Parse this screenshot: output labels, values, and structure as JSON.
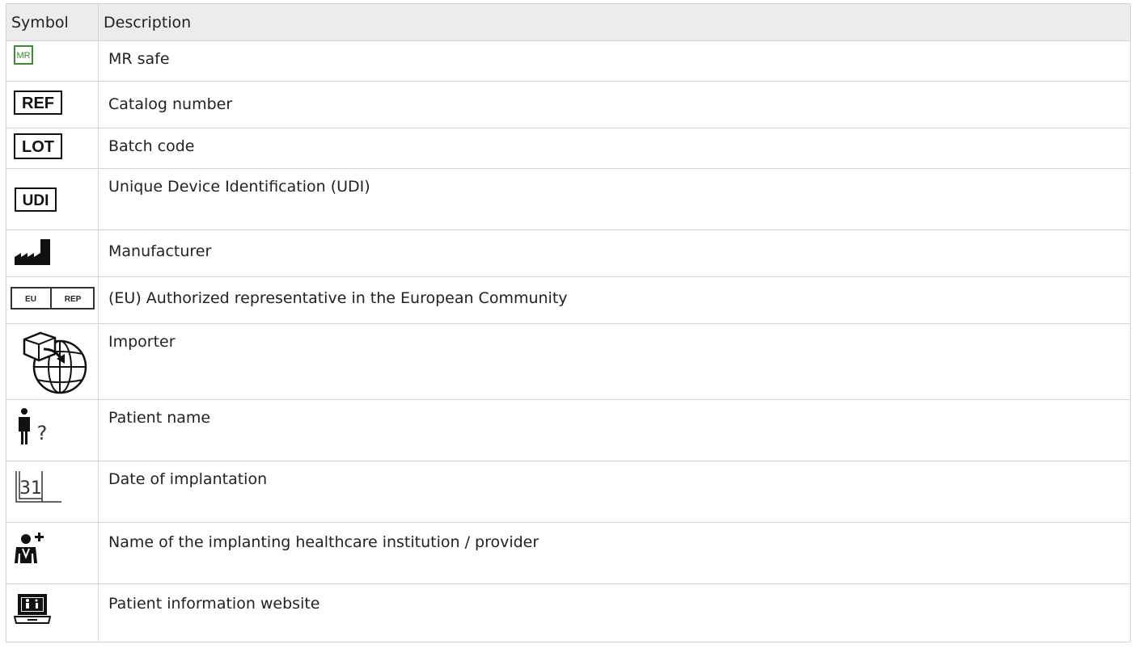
{
  "table": {
    "headers": [
      "Symbol",
      "Description"
    ],
    "rows": [
      {
        "icon": "mr-safe-icon",
        "description": "MR safe",
        "icon_text": "MR",
        "icon_color": "#3a8a3a"
      },
      {
        "icon": "ref-catalog-icon",
        "description": "Catalog number",
        "icon_text": "REF"
      },
      {
        "icon": "lot-batch-icon",
        "description": "Batch code",
        "icon_text": "LOT"
      },
      {
        "icon": "udi-icon",
        "description": "Unique Device Identification (UDI)",
        "icon_text": "UDI"
      },
      {
        "icon": "manufacturer-factory-icon",
        "description": "Manufacturer"
      },
      {
        "icon": "eu-rep-icon",
        "description": "(EU) Authorized representative in the European Community",
        "icon_text": "EU REP"
      },
      {
        "icon": "importer-globe-box-icon",
        "description": "Importer"
      },
      {
        "icon": "patient-name-icon",
        "description": "Patient name",
        "icon_text": "?"
      },
      {
        "icon": "date-calendar-icon",
        "description": "Date of implantation",
        "icon_text": "31"
      },
      {
        "icon": "healthcare-institution-icon",
        "description": "Name of the implanting healthcare institution / provider"
      },
      {
        "icon": "patient-info-website-icon",
        "description": "Patient information website"
      }
    ]
  }
}
